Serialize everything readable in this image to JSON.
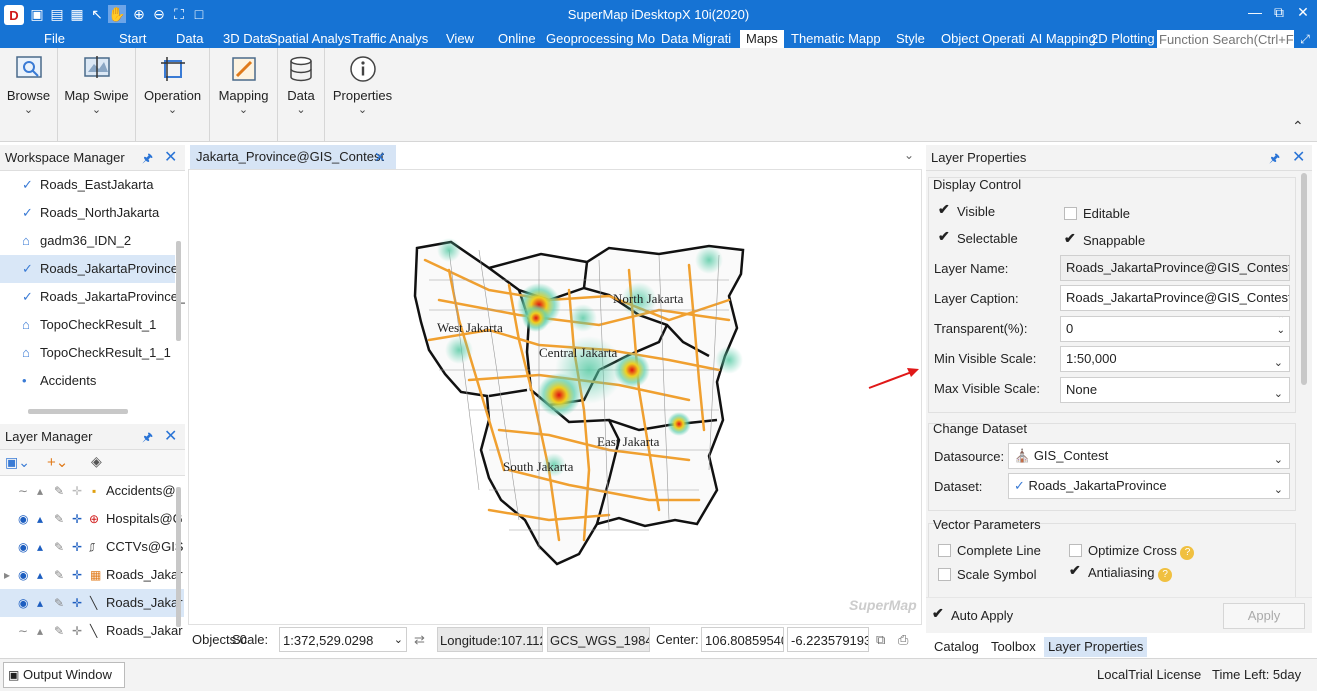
{
  "app": {
    "title": "SuperMap iDesktopX 10i(2020)"
  },
  "colors": {
    "accent": "#1673d4",
    "province_road": "#f0a030",
    "heat_hot": "#e01010",
    "heat_cool": "#60d0b0"
  },
  "menu": {
    "items": [
      "File",
      "Start",
      "Data",
      "3D Data",
      "Spatial Analys",
      "Traffic Analys",
      "View",
      "Online",
      "Geoprocessing Mo",
      "Data Migrati",
      "Maps",
      "Thematic Mapp",
      "Style",
      "Object Operati",
      "AI Mapping",
      "2D Plotting"
    ],
    "active": "Maps",
    "search_placeholder": "Function Search(Ctrl+F)"
  },
  "ribbon": {
    "groups": [
      {
        "label": "Browse",
        "icon": "browse-icon"
      },
      {
        "label": "Map Swipe",
        "icon": "map-swipe-icon"
      },
      {
        "label": "Operation",
        "icon": "operation-icon"
      },
      {
        "label": "Mapping",
        "icon": "mapping-icon"
      },
      {
        "label": "Data",
        "icon": "database-icon"
      },
      {
        "label": "Properties",
        "icon": "info-icon"
      }
    ]
  },
  "workspace": {
    "title": "Workspace Manager",
    "items": [
      {
        "label": "Roads_EastJakarta",
        "icon": "line-icon"
      },
      {
        "label": "Roads_NorthJakarta",
        "icon": "line-icon"
      },
      {
        "label": "gadm36_IDN_2",
        "icon": "region-icon"
      },
      {
        "label": "Roads_JakartaProvince",
        "icon": "line-icon",
        "selected": true
      },
      {
        "label": "Roads_JakartaProvince_",
        "icon": "line-icon"
      },
      {
        "label": "TopoCheckResult_1",
        "icon": "region-icon"
      },
      {
        "label": "TopoCheckResult_1_1",
        "icon": "region-icon"
      },
      {
        "label": "Accidents",
        "icon": "point-icon"
      }
    ]
  },
  "layer_manager": {
    "title": "Layer Manager",
    "rows": [
      {
        "label": "Accidents@",
        "visible": false
      },
      {
        "label": "Hospitals@G",
        "visible": true
      },
      {
        "label": "CCTVs@GIS",
        "visible": true
      },
      {
        "label": "Roads_Jakar",
        "visible": true
      },
      {
        "label": "Roads_Jakar",
        "visible": true,
        "selected": true
      },
      {
        "label": "Roads_Jakar",
        "visible": false
      }
    ]
  },
  "map": {
    "tab_label": "Jakarta_Province@GIS_Contest",
    "regions": [
      "North Jakarta",
      "West Jakarta",
      "Central Jakarta",
      "East Jakarta",
      "South Jakarta"
    ],
    "watermark": "SuperMap"
  },
  "map_status": {
    "objects": "Objects:0",
    "scale_label": "Scale:",
    "scale_value": "1:372,529.0298",
    "longitude": "Longitude:107.112",
    "crs": "GCS_WGS_1984",
    "center_label": "Center:",
    "center_x": "106.80859540",
    "center_y": "-6.223579193"
  },
  "layer_properties": {
    "title": "Layer Properties",
    "display_control": {
      "title": "Display Control",
      "visible": {
        "label": "Visible",
        "checked": true
      },
      "editable": {
        "label": "Editable",
        "checked": false
      },
      "selectable": {
        "label": "Selectable",
        "checked": true
      },
      "snappable": {
        "label": "Snappable",
        "checked": true
      },
      "layer_name_label": "Layer Name:",
      "layer_name": "Roads_JakartaProvince@GIS_Contest",
      "layer_caption_label": "Layer Caption:",
      "layer_caption": "Roads_JakartaProvince@GIS_Contest",
      "transparent_label": "Transparent(%):",
      "transparent": "0",
      "min_scale_label": "Min Visible Scale:",
      "min_scale": "1:50,000",
      "max_scale_label": "Max Visible Scale:",
      "max_scale": "None"
    },
    "change_dataset": {
      "title": "Change Dataset",
      "datasource_label": "Datasource:",
      "datasource": "GIS_Contest",
      "dataset_label": "Dataset:",
      "dataset": "Roads_JakartaProvince"
    },
    "vector_parameters": {
      "title": "Vector Parameters",
      "complete_line": {
        "label": "Complete Line",
        "checked": false
      },
      "optimize_cross": {
        "label": "Optimize Cross",
        "checked": false
      },
      "scale_symbol": {
        "label": "Scale Symbol",
        "checked": false
      },
      "antialiasing": {
        "label": "Antialiasing",
        "checked": true
      }
    },
    "auto_apply": {
      "label": "Auto Apply",
      "checked": true
    },
    "apply_label": "Apply"
  },
  "bottom_tabs": [
    "Catalog",
    "Toolbox",
    "Layer Properties"
  ],
  "output_window": "Output Window",
  "license": "LocalTrial License",
  "time_left": "Time Left: 5day"
}
